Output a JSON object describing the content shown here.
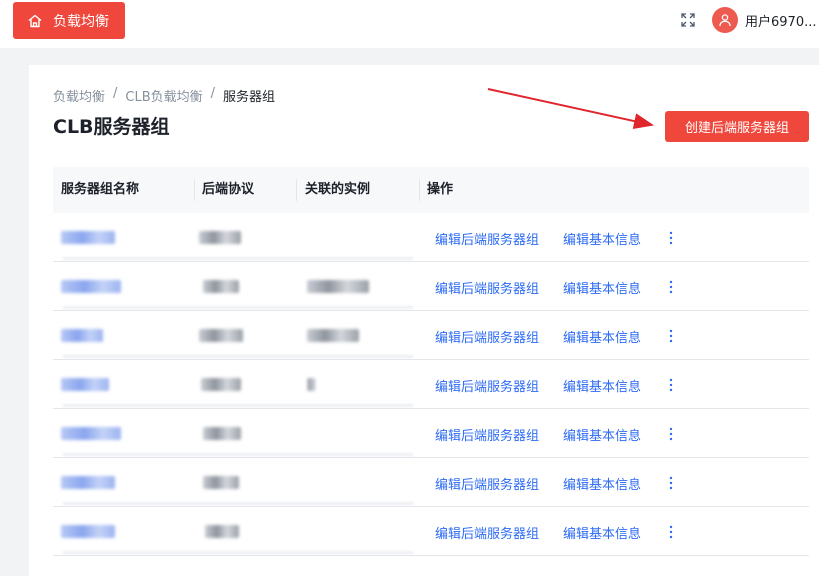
{
  "header": {
    "home_label": "负载均衡",
    "user_name": "用户6970..."
  },
  "breadcrumb": [
    "负载均衡",
    "CLB负载均衡",
    "服务器组"
  ],
  "page": {
    "title": "CLB服务器组",
    "create_button": "创建后端服务器组"
  },
  "table": {
    "columns": [
      "服务器组名称",
      "后端协议",
      "关联的实例",
      "操作"
    ],
    "actions": {
      "edit_backend": "编辑后端服务器组",
      "edit_basic": "编辑基本信息"
    },
    "row_count": 7
  },
  "colors": {
    "accent": "#f0473c",
    "link": "#2d6bf4",
    "annotation_arrow": "#e0252d"
  },
  "icons": [
    "home-icon",
    "fullscreen-icon",
    "user-icon",
    "more-vertical-icon",
    "annotation-arrow"
  ]
}
